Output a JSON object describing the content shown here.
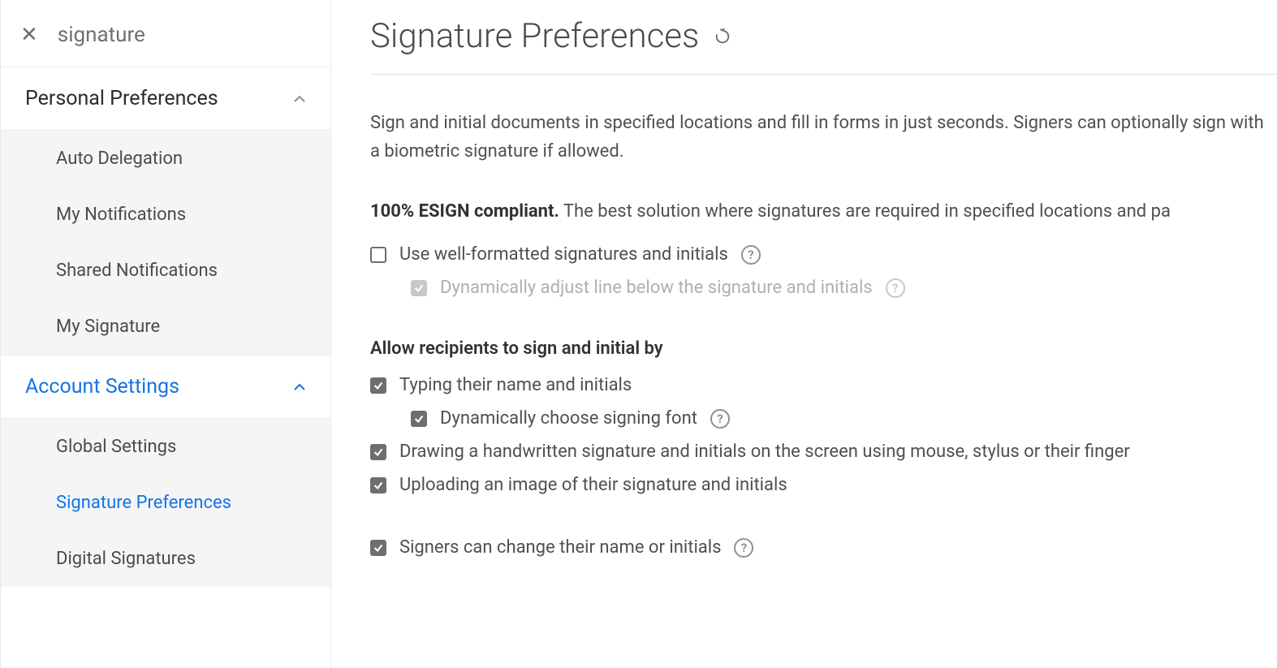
{
  "sidebar": {
    "searchText": "signature",
    "sections": [
      {
        "title": "Personal Preferences",
        "items": [
          {
            "label": "Auto Delegation"
          },
          {
            "label": "My Notifications"
          },
          {
            "label": "Shared Notifications"
          },
          {
            "label": "My Signature"
          }
        ]
      },
      {
        "title": "Account Settings",
        "items": [
          {
            "label": "Global Settings"
          },
          {
            "label": "Signature Preferences"
          },
          {
            "label": "Digital Signatures"
          }
        ]
      }
    ]
  },
  "main": {
    "title": "Signature Preferences",
    "description": "Sign and initial documents in specified locations and fill in forms in just seconds. Signers can optionally sign with a biometric signature if allowed.",
    "complianceBold": "100% ESIGN compliant.",
    "complianceRest": " The best solution where signatures are required in specified locations and pa",
    "opt1": "Use well-formatted signatures and initials",
    "opt1a": "Dynamically adjust line below the signature and initials",
    "sectionHeading": "Allow recipients to sign and initial by",
    "opt2": "Typing their name and initials",
    "opt2a": "Dynamically choose signing font",
    "opt3": "Drawing a handwritten signature and initials on the screen using mouse, stylus or their finger",
    "opt4": "Uploading an image of their signature and initials",
    "opt5": "Signers can change their name or initials"
  }
}
